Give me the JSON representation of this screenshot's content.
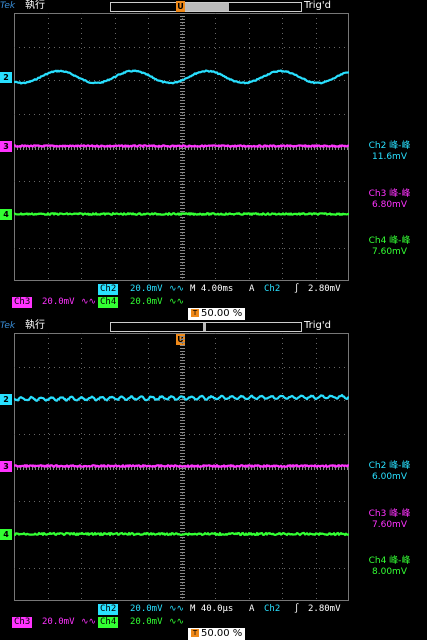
{
  "screens": [
    {
      "brand": "Tek",
      "status": "執行",
      "trig_state": "Trig'd",
      "trigger_marker": "U",
      "channel_markers": [
        {
          "label": "2",
          "color": "#29e0ff"
        },
        {
          "label": "3",
          "color": "#ff33ff"
        },
        {
          "label": "4",
          "color": "#33ff33"
        }
      ],
      "measurements": [
        {
          "name": "Ch2 峰-峰",
          "value": "11.6mV",
          "color": "#29e0ff"
        },
        {
          "name": "Ch3 峰-峰",
          "value": "6.80mV",
          "color": "#ff33ff"
        },
        {
          "name": "Ch4 峰-峰",
          "value": "7.60mV",
          "color": "#33ff33"
        }
      ],
      "status_line1": {
        "ch": "Ch2",
        "scale": "20.0mV",
        "bw": "∿∿",
        "timebase": "M 4.00ms",
        "trig_src_prefix": "A",
        "trig_ch": "Ch2",
        "trig_level": "2.80mV"
      },
      "status_line2": {
        "ch3": "Ch3",
        "ch3_scale": "20.0mV",
        "ch4": "Ch4",
        "ch4_scale": "20.0mV",
        "bw": "∿∿"
      },
      "trig_position": "50.00 %"
    },
    {
      "brand": "Tek",
      "status": "執行",
      "trig_state": "Trig'd",
      "trigger_marker": "U",
      "trig_position_top": "50.00 %",
      "channel_markers": [
        {
          "label": "2",
          "color": "#29e0ff"
        },
        {
          "label": "3",
          "color": "#ff33ff"
        },
        {
          "label": "4",
          "color": "#33ff33"
        }
      ],
      "measurements": [
        {
          "name": "Ch2 峰-峰",
          "value": "6.00mV",
          "color": "#29e0ff"
        },
        {
          "name": "Ch3 峰-峰",
          "value": "7.60mV",
          "color": "#ff33ff"
        },
        {
          "name": "Ch4 峰-峰",
          "value": "8.00mV",
          "color": "#33ff33"
        }
      ],
      "status_line1": {
        "ch": "Ch2",
        "scale": "20.0mV",
        "bw": "∿∿",
        "timebase": "M 40.0µs",
        "trig_src_prefix": "A",
        "trig_ch": "Ch2",
        "trig_level": "2.80mV"
      },
      "status_line2": {
        "ch3": "Ch3",
        "ch3_scale": "20.0mV",
        "ch4": "Ch4",
        "ch4_scale": "20.0mV",
        "bw": "∿∿"
      },
      "trig_position": "50.00 %"
    }
  ],
  "colors": {
    "ch2": "#29e0ff",
    "ch3": "#ff33ff",
    "ch4": "#33ff33",
    "trigger": "#f08a1a"
  }
}
